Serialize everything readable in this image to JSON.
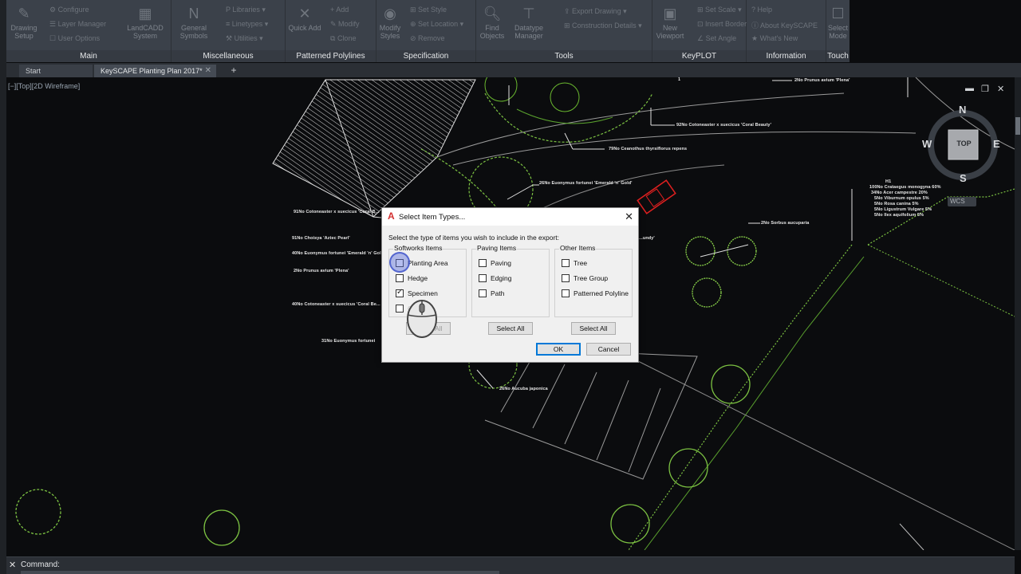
{
  "ribbon": {
    "panels": [
      {
        "title": "Main"
      },
      {
        "title": "Miscellaneous"
      },
      {
        "title": "Patterned Polylines"
      },
      {
        "title": "Specification"
      },
      {
        "title": "Tools"
      },
      {
        "title": "KeyPLOT"
      },
      {
        "title": "Information"
      },
      {
        "title": "Touch"
      }
    ],
    "buttons": {
      "drawing_setup": "Drawing\nSetup",
      "configure": "Configure",
      "layer_manager": "Layer Manager",
      "user_options": "User Options",
      "landcadd_system": "LandCADD\nSystem",
      "general_symbols": "General\nSymbols",
      "libraries": "Libraries",
      "linetypes": "Linetypes",
      "utilities": "Utilities",
      "quick_add": "Quick Add",
      "add": "Add",
      "modify": "Modify",
      "clone": "Clone",
      "modify_styles": "Modify\nStyles",
      "set_style": "Set Style",
      "set_location": "Set Location",
      "remove": "Remove",
      "find_objects": "Find\nObjects",
      "datatype_manager": "Datatype\nManager",
      "export_drawing": "Export Drawing",
      "construction_details": "Construction Details",
      "new_viewport": "New\nViewport",
      "set_scale": "Set Scale",
      "insert_border": "Insert Border",
      "set_angle": "Set Angle",
      "help": "Help",
      "about_keyscape": "About KeySCAPE",
      "whats_new": "What's New",
      "select_mode": "Select\nMode"
    }
  },
  "tabs": [
    {
      "label": "Start"
    },
    {
      "label": "KeySCAPE Planting Plan 2017*"
    }
  ],
  "viewport": {
    "label": "[−][Top][2D Wireframe]",
    "compass": {
      "n": "N",
      "s": "S",
      "e": "E",
      "w": "W",
      "top": "TOP",
      "wcs": "WCS"
    }
  },
  "annotations": [
    "2No Prunus avium 'Plena'",
    "1",
    "92No Cotoneaster x suecicus 'Coral Beauty'",
    "79No Ceanothus thyrsiflorus repens",
    "26No Euonymus fortunei 'Emerald 'n' Gold'",
    "91No Cotoneaster x suecicus 'Coral B...",
    "91No Choisya 'Aztec Pearl'",
    "40No Euonymus fortunei 'Emerald 'n' Gold'",
    "2No Prunus avium 'Plena'",
    "40No Cotoneaster x suecicus 'Coral Be...",
    "31No Euonymus fortunei",
    "26No Aucuba japonica",
    "2No Sorbus aucuparia",
    "H1",
    "100No Crataegus monogyna 60%",
    "34No Acer campestre 20%",
    "5No Viburnum opulus 5%",
    "5No Rosa canina 5%",
    "5No Ligustrum Vulgare 5%",
    "5No Ilex aquifolium 5%",
    "...undy'"
  ],
  "dialog": {
    "title": "Select Item Types...",
    "description": "Select the type of items you wish to include in the export:",
    "groups": [
      {
        "title": "Softworks Items",
        "items": [
          {
            "label": "Planting Area",
            "checked": false
          },
          {
            "label": "Hedge",
            "checked": false
          },
          {
            "label": "Specimen",
            "checked": true
          },
          {
            "label": "Grass",
            "checked": false
          }
        ],
        "button": "Select All"
      },
      {
        "title": "Paving Items",
        "items": [
          {
            "label": "Paving",
            "checked": false
          },
          {
            "label": "Edging",
            "checked": false
          },
          {
            "label": "Path",
            "checked": false
          }
        ],
        "button": "Select All"
      },
      {
        "title": "Other Items",
        "items": [
          {
            "label": "Tree",
            "checked": false
          },
          {
            "label": "Tree Group",
            "checked": false
          },
          {
            "label": "Patterned Polyline",
            "checked": false
          }
        ],
        "button": "Select All"
      }
    ],
    "ok": "OK",
    "cancel": "Cancel"
  },
  "command": {
    "label": "Command:"
  }
}
